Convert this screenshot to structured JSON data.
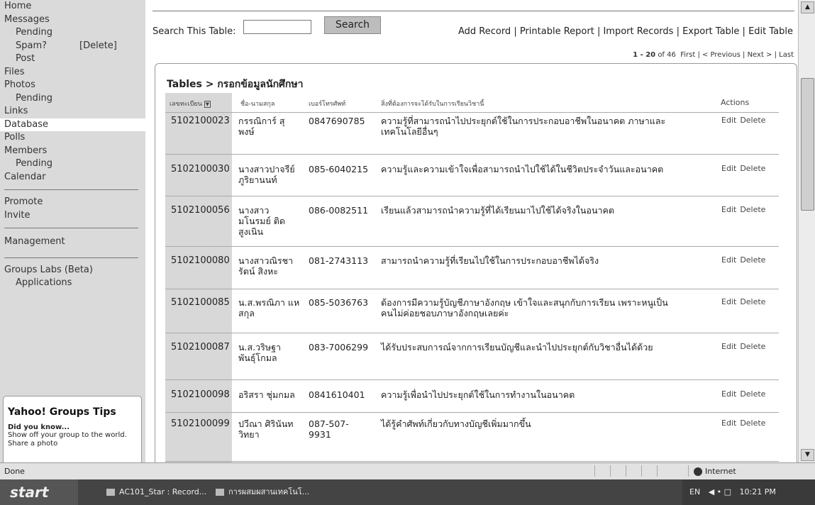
{
  "sidebar": {
    "home": "Home",
    "messages": "Messages",
    "messages_pending": "Pending",
    "spam": "Spam?",
    "spam_delete": "[Delete]",
    "post": "Post",
    "files": "Files",
    "photos": "Photos",
    "photos_pending": "Pending",
    "links": "Links",
    "database": "Database",
    "polls": "Polls",
    "members": "Members",
    "members_pending": "Pending",
    "calendar": "Calendar",
    "promote": "Promote",
    "invite": "Invite",
    "management": "Management",
    "labs": "Groups Labs (Beta)",
    "applications": "Applications"
  },
  "tips": {
    "title": "Yahoo! Groups Tips",
    "subtitle": "Did you know...",
    "body": "Show off your group to the world. Share a photo"
  },
  "search": {
    "label": "Search This Table:",
    "value": "",
    "button": "Search"
  },
  "actions": {
    "add": "Add Record",
    "report": "Printable Report",
    "import": "Import Records",
    "export": "Export Table",
    "edit": "Edit Table"
  },
  "pager": {
    "range": "1 - 20",
    "of": "of 46",
    "first": "First",
    "prev": "< Previous",
    "next": "Next >",
    "last": "Last"
  },
  "table": {
    "crumb_root": "Tables",
    "crumb_sep": ">",
    "crumb_name": "กรอกข้อมูลนักศึกษา",
    "headers": {
      "id": "เลขทะเบียน",
      "name": "ชื่อ-นามสกุล",
      "phone": "เบอร์โทรศัพท์",
      "expect": "สิ่งที่ต้องการจะได้รับในการเรียนวิชานี้",
      "actions": "Actions"
    },
    "edit_label": "Edit",
    "delete_label": "Delete",
    "rows": [
      {
        "id": "5102100023",
        "name": "กรรณิการ์ สุพงษ์",
        "phone": "0847690785",
        "expect": "ความรู้ที่สามารถนำไปประยุกต์ใช้ในการประกอบอาชีพในอนาคต ภาษาและเทคโนโลยีอื่นๆ"
      },
      {
        "id": "5102100030",
        "name": "นางสาวปาจรีย์ ภูริยานนท์",
        "phone": "085-6040215",
        "expect": "ความรู้และความเข้าใจเพื่อสามารถนำไปใช้ได้ในชีวิตประจำวันและอนาคต"
      },
      {
        "id": "5102100056",
        "name": "นางสาวมโนรมย์ ติดสูงเนิน",
        "phone": "086-0082511",
        "expect": "เรียนแล้วสามารถนำความรู้ที่ได้เรียนมาไปใช้ได้จริงในอนาคต"
      },
      {
        "id": "5102100080",
        "name": "นางสาวณิรชารัตน์ สิงหะ",
        "phone": "081-2743113",
        "expect": "สามารถนำความรู้ที่เรียนไปใช้ในการประกอบอาชีพได้จริง"
      },
      {
        "id": "5102100085",
        "name": "น.ส.พรณิภา แหสกุล",
        "phone": "085-5036763",
        "expect": "ต้องการมีความรู้บัญชีภาษาอังกฤษ เข้าใจและสนุกกับการเรียน เพราะหนูเป็นคนไม่ค่อยชอบภาษาอังกฤษเลยค่ะ"
      },
      {
        "id": "5102100087",
        "name": "น.ส.วริษฐา พันธุ์โกมล",
        "phone": "083-7006299",
        "expect": "ได้รับประสบการณ์จากการเรียนบัญชีและนำไปประยุกต์กับวิชาอื่นได้ด้วย"
      },
      {
        "id": "5102100098",
        "name": "อริสรา ชุ่มกมล",
        "phone": "0841610401",
        "expect": "ความรู้เพื่อนำไปประยุกต์ใช้ในการทำงานในอนาคต"
      },
      {
        "id": "5102100099",
        "name": "ปวีณา ศิรินันท วิทยา",
        "phone": "087-507-9931",
        "expect": "ได้รู้คำศัพท์เกี่ยวกับทางบัญชีเพิ่มมากขึ้น"
      }
    ]
  },
  "statusbar": {
    "status": "Done",
    "zone": "Internet"
  },
  "taskbar": {
    "start": "start",
    "task1": "AC101_Star : Record...",
    "task2": "การผสมผสานเทคโนโ...",
    "tray_lang": "EN",
    "clock": "10:21 PM"
  }
}
